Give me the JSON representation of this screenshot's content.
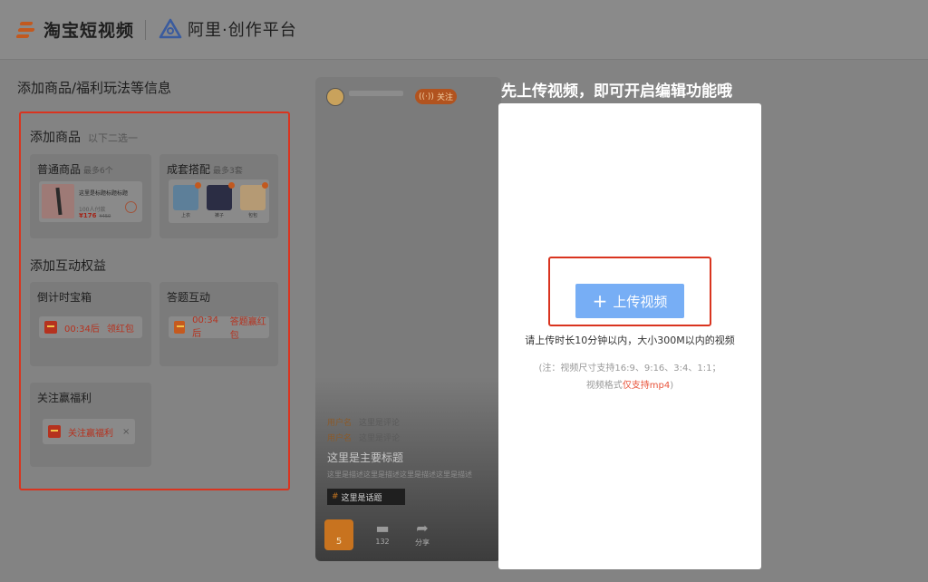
{
  "header": {
    "logo1_text": "淘宝短视频",
    "logo2_text": "阿里·创作平台"
  },
  "page_heading": "添加商品/福利玩法等信息",
  "left_panel": {
    "products_section": {
      "title": "添加商品",
      "subtitle": "以下二选一"
    },
    "normal_product": {
      "title": "普通商品",
      "limit": "最多6个",
      "product_title": "这里是标题标题标题",
      "meta": "100人付款",
      "price": "¥176",
      "old_price": "¥450"
    },
    "outfit": {
      "title": "成套搭配",
      "limit": "最多3套",
      "items": [
        "上衣",
        "裤子",
        "包包"
      ],
      "colors": [
        "#5d7f99",
        "#2b2d44",
        "#b59a74"
      ]
    },
    "interact_section": {
      "title": "添加互动权益"
    },
    "treasure_box": {
      "title": "倒计时宝箱",
      "time": "00:34后",
      "label": "领红包"
    },
    "quiz": {
      "title": "答题互动",
      "time": "00:34后",
      "label": "答题赢红包"
    },
    "follow_reward": {
      "title": "关注赢福利",
      "label": "关注赢福利",
      "close": "×"
    }
  },
  "phone_preview": {
    "follow_label": "关注",
    "comments": [
      {
        "user": "用户名",
        "text": "这里是评论"
      },
      {
        "user": "用户名",
        "text": "这里是评论"
      }
    ],
    "main_title": "这里是主要标题",
    "description": "这里是描述这里是描述这里是描述这里是描述",
    "topic_hash": "#",
    "topic": "这里是话题",
    "cart_count": "5",
    "comment_count": "132",
    "share_label": "分享"
  },
  "upload_modal": {
    "caption": "先上传视频，即可开启编辑功能哦",
    "button_label": "上传视频",
    "hint": "请上传时长10分钟以内，大小300M以内的视频",
    "note_line1": "(注：视频尺寸支持16:9、9:16、3:4、1:1；",
    "note_line2_prefix": "视频格式",
    "note_line2_highlight": "仅支持mp4",
    "note_line2_suffix": ")"
  }
}
